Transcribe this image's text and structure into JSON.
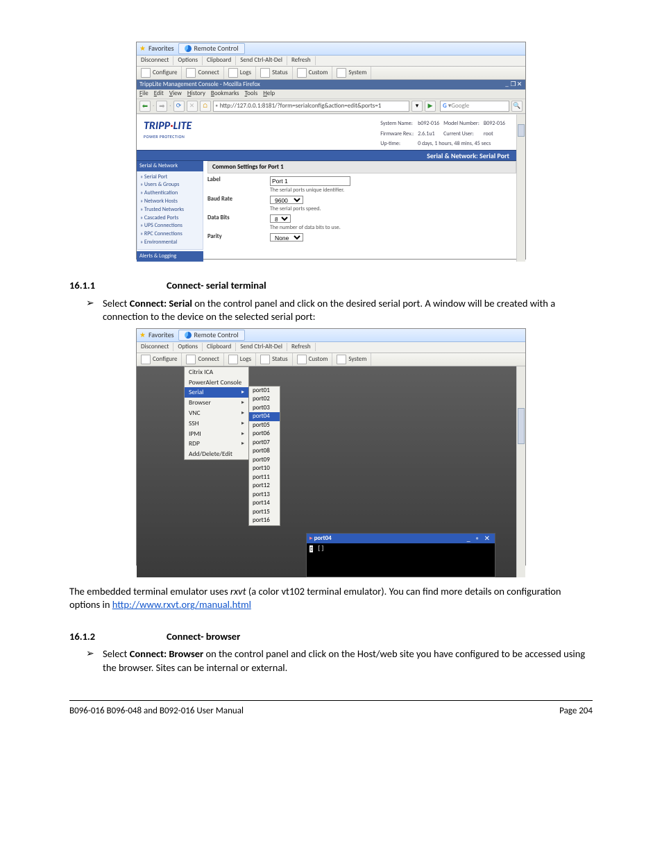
{
  "ss1": {
    "fav_label": "Favorites",
    "tab_label": "Remote Control",
    "toolbar1": [
      "Disconnect",
      "Options",
      "Clipboard",
      "Send Ctrl-Alt-Del",
      "Refresh"
    ],
    "toolbar2": [
      "Configure",
      "Connect",
      "Logs",
      "Status",
      "Custom",
      "System"
    ],
    "ff_title": "TrippLite Management Console - Mozilla Firefox",
    "ff_menu": [
      "File",
      "Edit",
      "View",
      "History",
      "Bookmarks",
      "Tools",
      "Help"
    ],
    "url": "http://127.0.0.1:8181/?form=serialconfig&action=edit&ports=1",
    "search_placeholder": "Google",
    "logo_main": "TRIPP",
    "logo_dot": "·",
    "logo_rest": "LITE",
    "logo_sub": "POWER PROTECTION",
    "sys": {
      "name_l": "System Name:",
      "name_v": "b092-016",
      "model_l": "Model Number:",
      "model_v": "B092-016",
      "fw_l": "Firmware Rev.:",
      "fw_v": "2.6.1u1",
      "user_l": "Current User:",
      "user_v": "root",
      "up_l": "Up-time:",
      "up_v": "0 days, 1 hours, 48 mins, 45 secs"
    },
    "bluebar": "Serial & Network: Serial Port",
    "nav_header": "Serial & Network",
    "nav_items": [
      "Serial Port",
      "Users & Groups",
      "Authentication",
      "Network Hosts",
      "Trusted Networks",
      "Cascaded Ports",
      "UPS Connections",
      "RPC Connections",
      "Environmental"
    ],
    "nav_footer": "Alerts & Logging",
    "section_title": "Common Settings for Port 1",
    "rows": {
      "label_l": "Label",
      "label_v": "Port 1",
      "label_h": "The serial ports unique identifier.",
      "baud_l": "Baud Rate",
      "baud_v": "9600",
      "baud_h": "The serial ports speed.",
      "bits_l": "Data Bits",
      "bits_v": "8",
      "bits_h": "The number of data bits to use.",
      "parity_l": "Parity",
      "parity_v": "None"
    }
  },
  "sections": {
    "s1_num": "16.1.1",
    "s1_title": "Connect- serial terminal",
    "s1_bullet_pre": "Select ",
    "s1_bullet_bold": "Connect: Serial",
    "s1_bullet_post": " on the control panel and click on the desired serial port. A window will be created with a connection to the device on the selected serial port:",
    "s2_num": "16.1.2",
    "s2_title": "Connect- browser",
    "s2_bullet_pre": "Select ",
    "s2_bullet_bold": "Connect: Browser",
    "s2_bullet_post": " on the control panel and click on the Host/web site you have configured to be accessed using the browser. Sites can be internal or external."
  },
  "ss2": {
    "fav_label": "Favorites",
    "tab_label": "Remote Control",
    "toolbar1": [
      "Disconnect",
      "Options",
      "Clipboard",
      "Send Ctrl-Alt-Del",
      "Refresh"
    ],
    "toolbar2": [
      "Configure",
      "Connect",
      "Logs",
      "Status",
      "Custom",
      "System"
    ],
    "menu_top": [
      "Citrix ICA",
      "PowerAlert Console"
    ],
    "menu_main": [
      {
        "t": "Serial",
        "sel": true,
        "a": true
      },
      {
        "t": "Browser",
        "a": true
      },
      {
        "t": "VNC",
        "a": true
      },
      {
        "t": "SSH",
        "a": true
      },
      {
        "t": "IPMI",
        "a": true
      },
      {
        "t": "RDP",
        "a": true
      },
      {
        "t": "Add/Delete/Edit",
        "a": false
      }
    ],
    "ports": [
      "port01",
      "port02",
      "port03",
      "port04",
      "port05",
      "port06",
      "port07",
      "port08",
      "port09",
      "port10",
      "port11",
      "port12",
      "port13",
      "port14",
      "port15",
      "port16"
    ],
    "port_sel": 3,
    "term_title": "port04",
    "term_body": "[]"
  },
  "para_after_ss2_a": "The embedded terminal emulator uses ",
  "para_after_ss2_i": "rxvt",
  "para_after_ss2_b": " (a color vt102 terminal emulator). You can find more details on configuration options in ",
  "para_link": "http://www.rxvt.org/manual.html",
  "footer_left": "B096-016 B096-048 and B092-016 User Manual",
  "footer_right": "Page 204"
}
